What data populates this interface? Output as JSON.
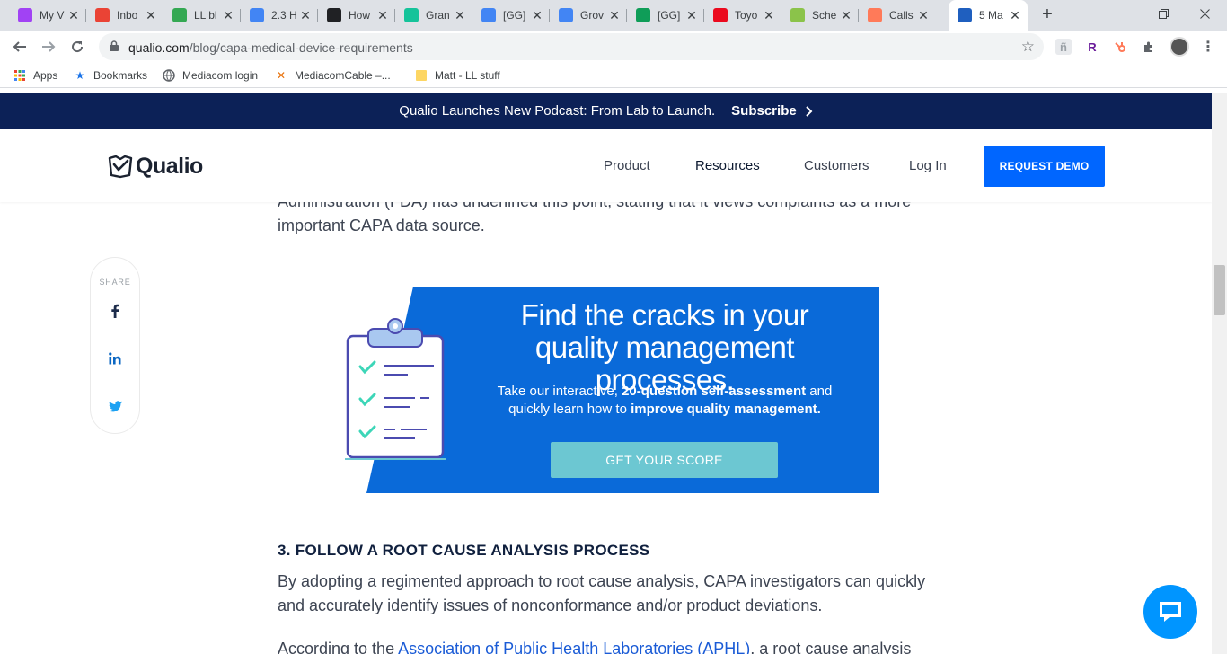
{
  "browser": {
    "tabs": [
      {
        "title": "My V",
        "favicon": "sheets-purple-icon",
        "color": "#a142f4"
      },
      {
        "title": "Inbo",
        "favicon": "gmail-icon",
        "color": "#ea4335"
      },
      {
        "title": "LL bl",
        "favicon": "drive-icon",
        "color": "#34a853"
      },
      {
        "title": "2.3 H",
        "favicon": "docs-icon",
        "color": "#4285f4"
      },
      {
        "title": "How",
        "favicon": "checkered-icon",
        "color": "#202124"
      },
      {
        "title": "Gran",
        "favicon": "grammarly-icon",
        "color": "#15c39a"
      },
      {
        "title": "[GG]",
        "favicon": "docs-icon",
        "color": "#4285f4"
      },
      {
        "title": "Grov",
        "favicon": "docs-icon",
        "color": "#4285f4"
      },
      {
        "title": "[GG]",
        "favicon": "sheets-icon",
        "color": "#0f9d58"
      },
      {
        "title": "Toyo",
        "favicon": "toyota-icon",
        "color": "#eb0a1e"
      },
      {
        "title": "Sche",
        "favicon": "schedule-icon",
        "color": "#8bc34a"
      },
      {
        "title": "Calls",
        "favicon": "hubspot-icon",
        "color": "#ff7a59"
      },
      {
        "title": "5 Ma",
        "favicon": "qualio-icon",
        "color": "#1f5fbf"
      }
    ],
    "url_host": "qualio.com",
    "url_path": "/blog/capa-medical-device-requirements",
    "bookmarks": [
      {
        "label": "Apps",
        "icon": "apps-grid-icon"
      },
      {
        "label": "Bookmarks",
        "icon": "star-icon"
      },
      {
        "label": "Mediacom login",
        "icon": "globe-icon"
      },
      {
        "label": "MediacomCable –...",
        "icon": "mediacom-icon"
      },
      {
        "label": "Matt - LL stuff",
        "icon": "folder-icon"
      }
    ]
  },
  "announcement": {
    "text": "Qualio Launches New Podcast: From Lab to Launch.",
    "cta": "Subscribe"
  },
  "site_nav": {
    "logo": "Qualio",
    "links": [
      "Product",
      "Resources",
      "Customers",
      "Log In"
    ],
    "demo_button": "REQUEST DEMO"
  },
  "share": {
    "label": "SHARE"
  },
  "article": {
    "intro_line1": "Administration (FDA) has underlined this point, stating that it views complaints as a more",
    "intro_line2": "important CAPA data source.",
    "banner": {
      "headline": "Find the cracks in your quality management processes.",
      "sub_prefix": "Take our interactive, ",
      "sub_bold1": "20-question self-assessment",
      "sub_mid": " and quickly learn how to ",
      "sub_bold2": "improve quality management.",
      "cta": "GET YOUR SCORE"
    },
    "section_heading": "3. FOLLOW A ROOT CAUSE ANALYSIS PROCESS",
    "para1_line1": "By adopting a regimented approach to root cause analysis, CAPA investigators can quickly",
    "para1_line2": "and accurately identify issues of nonconformance and/or product deviations.",
    "para2_prefix": "According to the ",
    "para2_link": "Association of Public Health Laboratories (APHL)",
    "para2_suffix": ", a root cause analysis"
  },
  "colors": {
    "announce_bg": "#0c2157",
    "primary_blue": "#0066ff",
    "banner_blue": "#0a6ad9",
    "cta_teal": "#6cc7d2",
    "link": "#1a5bd6"
  }
}
